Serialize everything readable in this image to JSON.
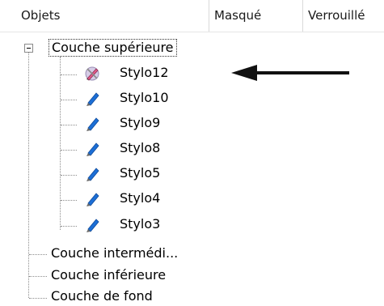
{
  "columns": {
    "objects": "Objets",
    "hidden": "Masqué",
    "locked": "Verrouillé"
  },
  "tree": {
    "top_layer": {
      "label": "Couche supérieure",
      "children": [
        "Stylo12",
        "Stylo10",
        "Stylo9",
        "Stylo8",
        "Stylo5",
        "Stylo4",
        "Stylo3"
      ]
    },
    "middle_layer": "Couche intermédi...",
    "lower_layer": "Couche inférieure",
    "background_layer": "Couche de fond"
  },
  "icons": {
    "expander": "collapse-minus-icon",
    "stylo12": "pen-disabled-icon",
    "pen": "blue-pen-icon",
    "arrow": "left-arrow-icon"
  },
  "colors": {
    "pen_blue": "#1c6fd6",
    "arrow": "#111111"
  }
}
